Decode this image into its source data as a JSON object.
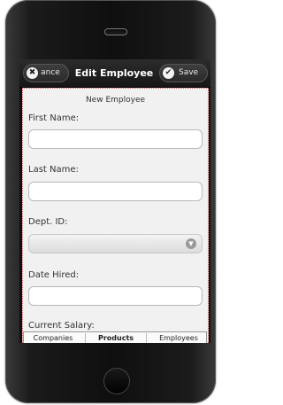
{
  "nav": {
    "title": "Edit Employee",
    "cancel_label": "ance",
    "save_label": "Save",
    "cancel_icon": "✖",
    "save_icon": "✔"
  },
  "form": {
    "heading": "New Employee",
    "first_name_label": "First Name:",
    "first_name_value": "",
    "last_name_label": "Last Name:",
    "last_name_value": "",
    "dept_label": "Dept. ID:",
    "dept_value": "",
    "date_hired_label": "Date Hired:",
    "date_hired_value": "",
    "salary_label": "Current Salary:"
  },
  "tabs": [
    {
      "label": "Companies"
    },
    {
      "label": "Products"
    },
    {
      "label": "Employees"
    }
  ],
  "icons": {
    "cancel": "close-icon",
    "save": "checkmark-icon",
    "dropdown": "chevron-down-icon"
  }
}
